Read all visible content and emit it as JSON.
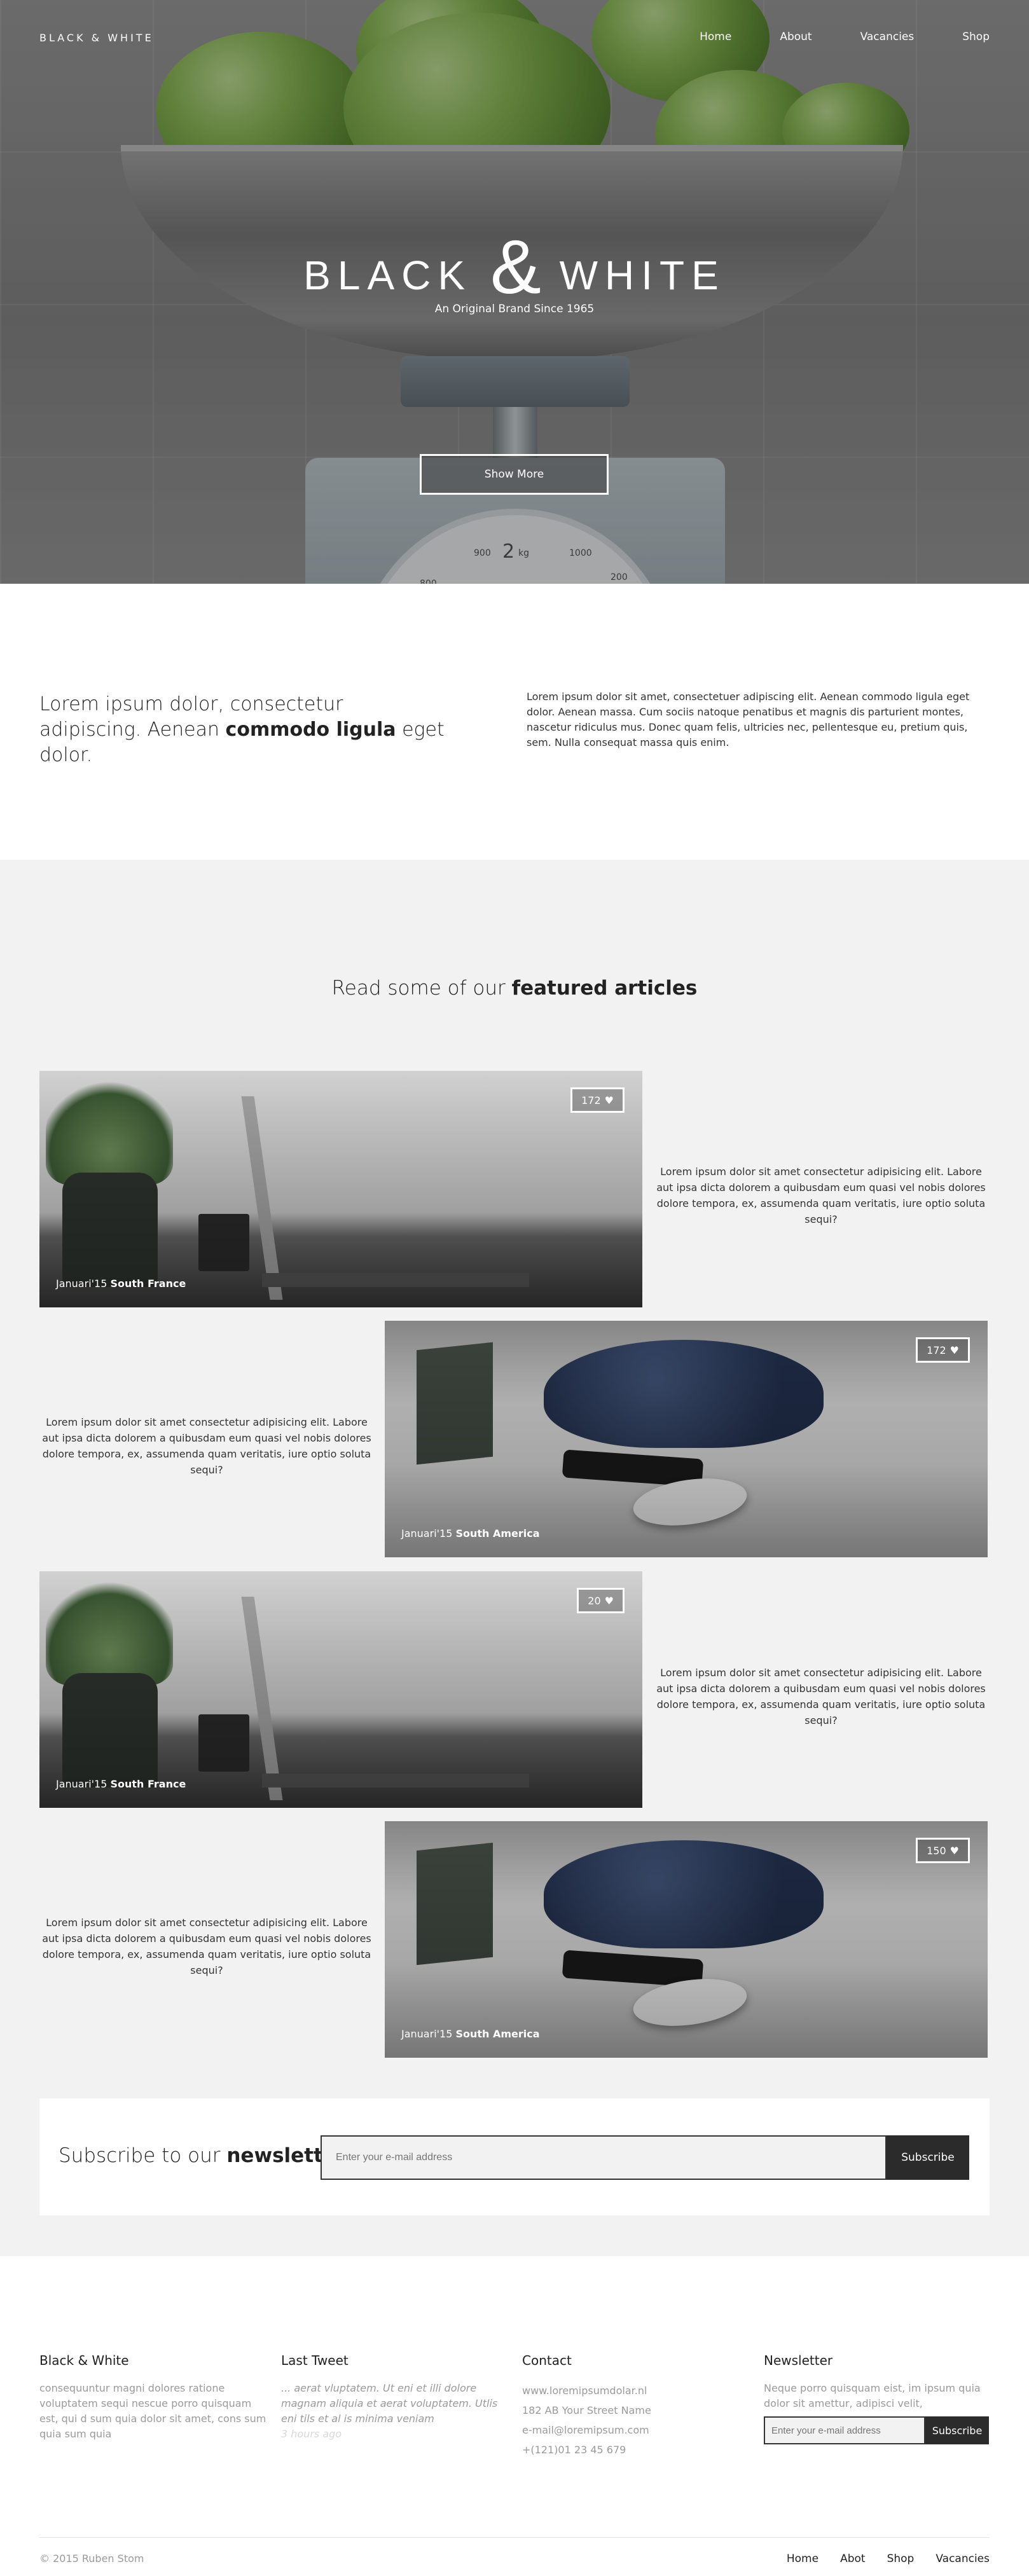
{
  "brand": "BLACK & WHITE",
  "nav": [
    "Home",
    "About",
    "Vacancies",
    "Shop"
  ],
  "hero": {
    "title_left": "BLACK",
    "title_amp": "&",
    "title_right": "WHITE",
    "subtitle": "An Original Brand Since 1965",
    "button": "Show More",
    "dial_numbers": [
      "2",
      "kg",
      "1000",
      "900",
      "200",
      "800"
    ]
  },
  "intro": {
    "lead_part1": "Lorem ipsum dolor, consectetur adipiscing. Aenean ",
    "lead_bold": "commodo ligula",
    "lead_part2": " eget dolor.",
    "text": "Lorem ipsum dolor sit amet, consectetuer adipiscing elit. Aenean commodo ligula eget dolor. Aenean massa. Cum sociis natoque penatibus et magnis dis parturient montes, nascetur ridiculus mus. Donec quam felis, ultricies nec, pellentesque eu, pretium quis, sem. Nulla consequat massa quis enim."
  },
  "articles": {
    "heading_part1": "Read some of our ",
    "heading_bold": "featured articles",
    "items": [
      {
        "likes": "172",
        "date": "Januari'15",
        "location": "South France",
        "text": "Lorem ipsum dolor sit amet consectetur adipisicing elit. Labore aut ipsa dicta dolorem a quibusdam eum quasi vel nobis dolores dolore tempora, ex, assumenda quam veritatis, iure optio soluta sequi?"
      },
      {
        "likes": "172",
        "date": "Januari'15",
        "location": "South America",
        "text": "Lorem ipsum dolor sit amet consectetur adipisicing elit. Labore aut ipsa dicta dolorem a quibusdam eum quasi vel nobis dolores dolore tempora, ex, assumenda quam veritatis, iure optio soluta sequi?"
      },
      {
        "likes": "20",
        "date": "Januari'15",
        "location": "South France",
        "text": "Lorem ipsum dolor sit amet consectetur adipisicing elit. Labore aut ipsa dicta dolorem a quibusdam eum quasi vel nobis dolores dolore tempora, ex, assumenda quam veritatis, iure optio soluta sequi?"
      },
      {
        "likes": "150",
        "date": "Januari'15",
        "location": "South America",
        "text": "Lorem ipsum dolor sit amet consectetur adipisicing elit. Labore aut ipsa dicta dolorem a quibusdam eum quasi vel nobis dolores dolore tempora, ex, assumenda quam veritatis, iure optio soluta sequi?"
      }
    ],
    "heart_icon": "heart-icon"
  },
  "newsletter": {
    "title_part1": "Subscribe to our ",
    "title_bold": "newsletter",
    "placeholder": "Enter your e-mail address",
    "button": "Subscribe"
  },
  "footer": {
    "col1": {
      "title": "Black & White",
      "text": "consequuntur magni dolores ratione voluptatem sequi nescue porro quisquam est, qui d sum quia dolor sit amet, cons sum quia sum quia"
    },
    "col2": {
      "title": "Last Tweet",
      "text": "... aerat vluptatem. Ut eni et illi dolore magnam aliquia et aerat voluptatem. Utlis eni tils et al is minima veniam",
      "time": "3 hours ago"
    },
    "col3": {
      "title": "Contact",
      "lines": [
        "www.loremipsumdolar.nl",
        "182 AB Your Street Name",
        "e-mail@loremipsum.com",
        "+(121)01 23 45 679"
      ]
    },
    "col4": {
      "title": "Newsletter",
      "text": "Neque porro quisquam eist, im ipsum quia dolor sit amettur, adipisci velit,",
      "placeholder": "Enter your e-mail address",
      "button": "Subscribe"
    },
    "copyright": "© 2015 Ruben Stom",
    "nav": [
      "Home",
      "Abot",
      "Shop",
      "Vacancies"
    ]
  },
  "colors": {
    "dark": "#2b2b2b",
    "panel": "#f2f2f2",
    "muted": "#9a9a9a"
  }
}
